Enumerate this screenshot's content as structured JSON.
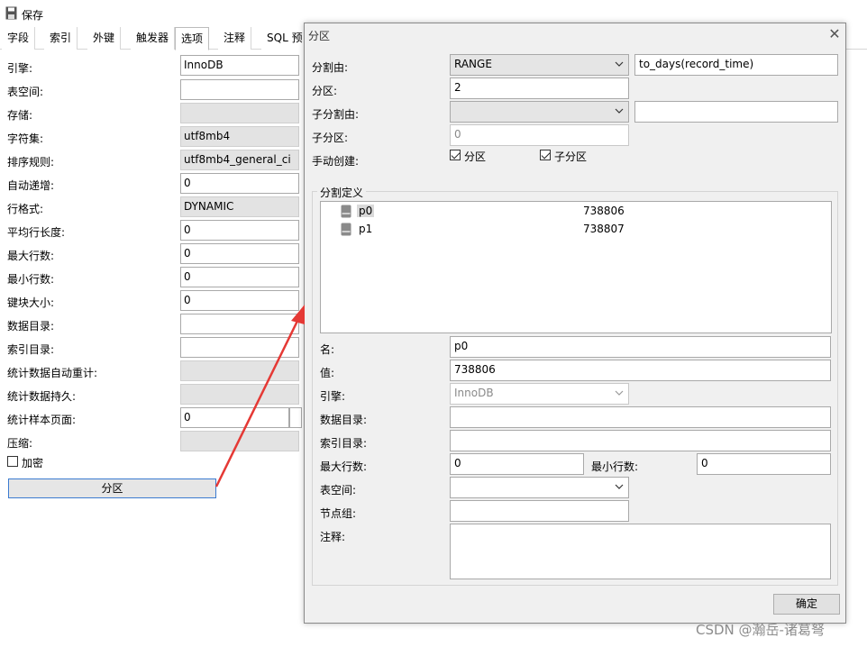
{
  "toolbar": {
    "save_label": "保存"
  },
  "tabs": [
    {
      "label": "字段"
    },
    {
      "label": "索引"
    },
    {
      "label": "外键"
    },
    {
      "label": "触发器"
    },
    {
      "label": "选项"
    },
    {
      "label": "注释"
    },
    {
      "label": "SQL 预"
    }
  ],
  "options": {
    "engine_label": "引擎:",
    "engine_value": "InnoDB",
    "tablespace_label": "表空间:",
    "storage_label": "存储:",
    "charset_label": "字符集:",
    "charset_value": "utf8mb4",
    "collation_label": "排序规则:",
    "collation_value": "utf8mb4_general_ci",
    "auto_increment_label": "自动递增:",
    "auto_increment_value": "0",
    "row_format_label": "行格式:",
    "row_format_value": "DYNAMIC",
    "avg_row_length_label": "平均行长度:",
    "avg_row_length_value": "0",
    "max_rows_label": "最大行数:",
    "max_rows_value": "0",
    "min_rows_label": "最小行数:",
    "min_rows_value": "0",
    "key_block_size_label": "键块大小:",
    "key_block_size_value": "0",
    "data_directory_label": "数据目录:",
    "index_directory_label": "索引目录:",
    "stats_auto_recalc_label": "统计数据自动重计:",
    "stats_persistent_label": "统计数据持久:",
    "stats_sample_pages_label": "统计样本页面:",
    "stats_sample_pages_value": "0",
    "compression_label": "压缩:",
    "encryption_label": "加密",
    "partition_button": "分区"
  },
  "dialog": {
    "title": "分区",
    "partition_by_label": "分割由:",
    "partition_by_value": "RANGE",
    "partition_expr_value": "to_days(record_time)",
    "partitions_label": "分区:",
    "partitions_value": "2",
    "subpartition_by_label": "子分割由:",
    "subpartitions_label": "子分区:",
    "subpartitions_value": "0",
    "manual_create_label": "手动创建:",
    "manual_partition_label": "分区",
    "manual_subpartition_label": "子分区",
    "definition_title": "分割定义",
    "partitions": [
      {
        "name": "p0",
        "value": "738806"
      },
      {
        "name": "p1",
        "value": "738807"
      }
    ],
    "name_label": "名:",
    "name_value": "p0",
    "value_label": "值:",
    "value_value": "738806",
    "engine_label": "引擎:",
    "engine_value": "InnoDB",
    "data_dir_label": "数据目录:",
    "index_dir_label": "索引目录:",
    "max_rows_label": "最大行数:",
    "max_rows_value": "0",
    "min_rows_label": "最小行数:",
    "min_rows_value": "0",
    "tablespace_label": "表空间:",
    "nodegroup_label": "节点组:",
    "comment_label": "注释:",
    "ok_button": "确定"
  },
  "watermark": "CSDN @瀚岳-诸葛弩",
  "colors": {
    "arrow": "#e53935",
    "button_focus": "#3b7bd0"
  }
}
